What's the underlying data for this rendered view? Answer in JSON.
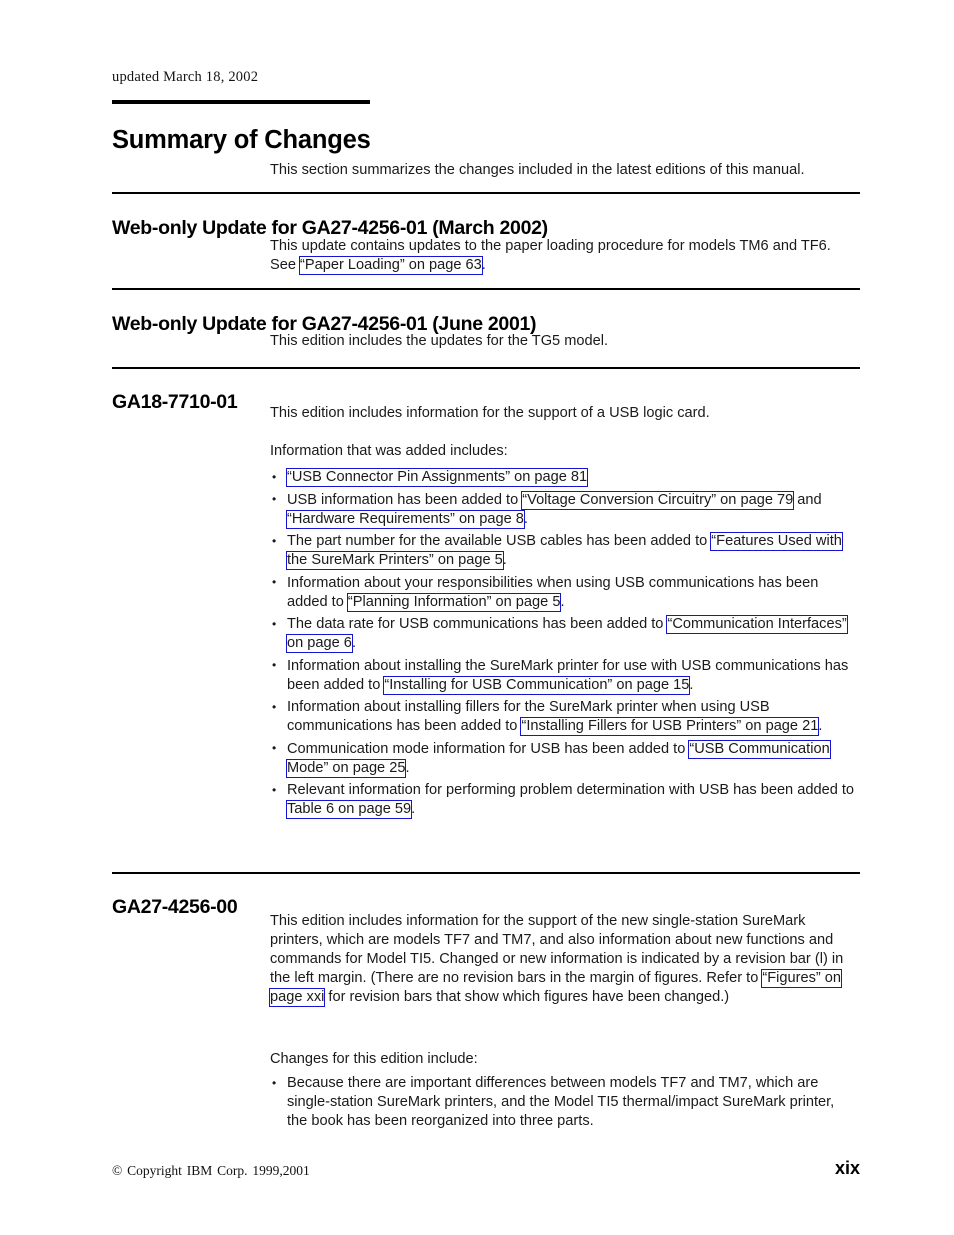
{
  "header": {
    "updated_note": "updated March 18, 2002",
    "chapter_title": "Summary of Changes",
    "intro": "This section summarizes the changes included in the latest editions of this manual."
  },
  "sections": [
    {
      "heading": "Web-only Update for GA27-4256-01 (March 2002)",
      "paragraph_pre": "This update contains updates to the paper loading procedure for models TM6 and TF6. See ",
      "link": "“Paper Loading” on page 63",
      "paragraph_post": "."
    },
    {
      "heading": "Web-only Update for GA27-4256-01 (June 2001)",
      "paragraph": "This edition includes the updates for the TG5 model."
    },
    {
      "heading": "GA18-7710-01",
      "paragraph": "This edition includes information for the support of a USB logic card.",
      "list_intro": "Information that was added includes:",
      "bullets": [
        {
          "pre": "",
          "link1": "“USB Connector Pin Assignments” on page 81",
          "mid": "",
          "link2": "",
          "post": ""
        },
        {
          "pre": "USB information has been added to ",
          "link1": "“Voltage Conversion Circuitry” on page 79",
          "mid": " and ",
          "link2": "“Hardware Requirements” on page 8",
          "post": "."
        },
        {
          "pre": "The part number for the available USB cables has been added to ",
          "link1": "“Features Used with the SureMark Printers” on page 5",
          "mid": "",
          "link2": "",
          "post": "."
        },
        {
          "pre": "Information about your responsibilities when using USB communications has been added to ",
          "link1": "“Planning Information” on page 5",
          "mid": "",
          "link2": "",
          "post": "."
        },
        {
          "pre": "The data rate for USB communications has been added to ",
          "link1": "“Communication Interfaces” on page 6",
          "mid": "",
          "link2": "",
          "post": "."
        },
        {
          "pre": "Information about installing the SureMark printer for use with USB communications has been added to ",
          "link1": "“Installing for USB Communication” on page 15",
          "mid": "",
          "link2": "",
          "post": "."
        },
        {
          "pre": "Information about installing fillers for the SureMark printer when using USB communications has been added to ",
          "link1": "“Installing Fillers for USB Printers” on page 21",
          "mid": "",
          "link2": "",
          "post": "."
        },
        {
          "pre": "Communication mode information for USB has been added to ",
          "link1": "“USB Communication Mode” on page 25",
          "mid": "",
          "link2": "",
          "post": "."
        },
        {
          "pre": "Relevant information for performing problem determination with USB has been added to ",
          "link1": "Table 6 on page 59",
          "mid": "",
          "link2": "",
          "post": "."
        }
      ]
    },
    {
      "heading": "GA27-4256-00",
      "paragraph_pre": "This edition includes information for the support of the new single-station SureMark printers, which are models TF7 and TM7, and also information about new functions and commands for Model TI5. Changed or new information is indicated by a revision bar (l) in the left margin. (There are no revision bars in the margin of figures. Refer to ",
      "link": "“Figures” on page xxi",
      "paragraph_post": " for revision bars that show which figures have been changed.)",
      "list_intro": "Changes for this edition include:",
      "bullets": [
        {
          "text": "Because there are important differences between models TF7 and TM7, which are single-station SureMark printers, and the Model TI5 thermal/impact SureMark printer, the book has been reorganized into three parts."
        }
      ]
    }
  ],
  "footer": {
    "copyright": "© Copyright IBM Corp. 1999,2001",
    "page_number": "xix"
  },
  "colors": {
    "link_border": "#1414d2",
    "text": "#1a1a1a",
    "rule": "#000000"
  }
}
